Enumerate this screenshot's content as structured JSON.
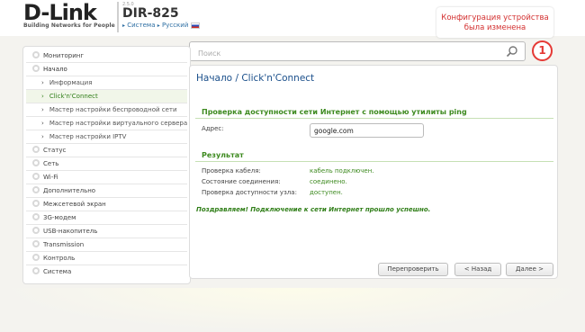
{
  "header": {
    "brand": "D-Link",
    "tagline": "Building Networks for People",
    "hw_version": "2.5.0",
    "model": "DIR-825",
    "breadcrumb_system": "Система",
    "language": "Русский",
    "notice": "Конфигурация устройства была изменена"
  },
  "search": {
    "placeholder": "Поиск"
  },
  "notifications": {
    "count": "1"
  },
  "colors": {
    "accent_green": "#3d8a1f",
    "title_blue": "#1a4f8b",
    "notice_red": "#d32f2f"
  },
  "sidebar": {
    "items": [
      {
        "label": "Мониторинг"
      },
      {
        "label": "Начало"
      },
      {
        "label": "Информация"
      },
      {
        "label": "Click'n'Connect"
      },
      {
        "label": "Мастер настройки беспроводной сети"
      },
      {
        "label": "Мастер настройки виртуального сервера"
      },
      {
        "label": "Мастер настройки IPTV"
      },
      {
        "label": "Статус"
      },
      {
        "label": "Сеть"
      },
      {
        "label": "Wi-Fi"
      },
      {
        "label": "Дополнительно"
      },
      {
        "label": "Межсетевой экран"
      },
      {
        "label": "3G-модем"
      },
      {
        "label": "USB-накопитель"
      },
      {
        "label": "Transmission"
      },
      {
        "label": "Контроль"
      },
      {
        "label": "Система"
      }
    ]
  },
  "main": {
    "title": "Начало /  Click'n'Connect",
    "ping_section": {
      "title": "Проверка доступности сети Интернет с помощью утилиты ping",
      "address_label": "Адрес:",
      "address_value": "google.com"
    },
    "result_section": {
      "title": "Результат",
      "rows": [
        {
          "label": "Проверка кабеля:",
          "value": "кабель подключен."
        },
        {
          "label": "Состояние соединения:",
          "value": "соединено."
        },
        {
          "label": "Проверка доступности узла:",
          "value": "доступен."
        }
      ]
    },
    "success_message": "Поздравляем! Подключение к сети Интернет прошло успешно.",
    "buttons": {
      "recheck": "Перепроверить",
      "back": "< Назад",
      "next": "Далее >"
    }
  }
}
